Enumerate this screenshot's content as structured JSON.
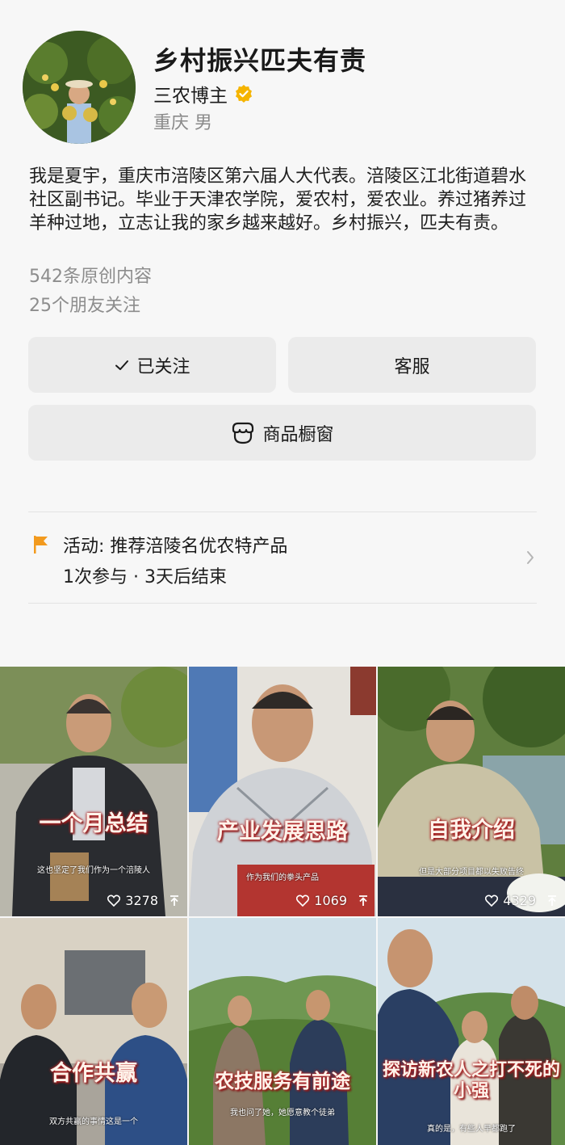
{
  "profile": {
    "name": "乡村振兴匹夫有责",
    "role": "三农博主",
    "location": "重庆 男",
    "bio": "我是夏宇，重庆市涪陵区第六届人大代表。涪陵区江北街道碧水社区副书记。毕业于天津农学院，爱农村，爱农业。养过猪养过羊种过地，立志让我的家乡越来越好。乡村振兴，匹夫有责。",
    "original_count": "542条原创内容",
    "friends_follow": "25个朋友关注"
  },
  "buttons": {
    "followed": "已关注",
    "service": "客服",
    "shop": "商品橱窗"
  },
  "activity": {
    "title": "活动: 推荐涪陵名优农特产品",
    "meta": "1次参与 · 3天后结束"
  },
  "icons": {
    "check": "check-icon",
    "shop": "shop-icon",
    "flag": "flag-icon",
    "chevron": "chevron-right-icon",
    "heart": "heart-icon",
    "share": "share-icon",
    "verified": "verified-badge-icon"
  },
  "colors": {
    "verified": "#f5b400",
    "flag": "#f29a1e",
    "caption_outline": "#b4282a"
  },
  "videos": [
    {
      "caption": "一个月总结",
      "subtitle": "这也坚定了我们作为一个涪陵人",
      "likes": "3278"
    },
    {
      "caption": "产业发展思路",
      "subtitle": "作为我们的拳头产品",
      "likes": "1069"
    },
    {
      "caption": "自我介绍",
      "subtitle": "但是大部分项目都以失败告终",
      "likes": "4329"
    },
    {
      "caption": "合作共赢",
      "subtitle": "双方共赢的事情这是一个",
      "likes": ""
    },
    {
      "caption": "农技服务有前途",
      "subtitle": "我也问了她，她愿意教个徒弟",
      "likes": ""
    },
    {
      "caption": "探访新农人之打不死的小强",
      "subtitle": "真的是，有些人早都跑了",
      "likes": ""
    }
  ]
}
